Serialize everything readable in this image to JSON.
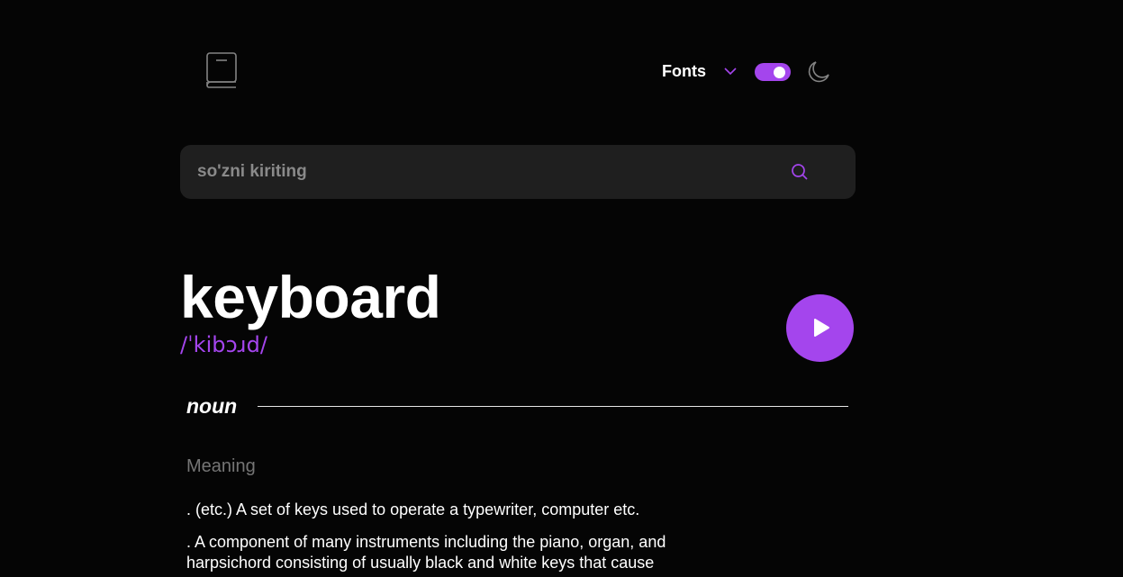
{
  "header": {
    "logo_icon": "book-icon",
    "font_selector": {
      "label": "Fonts",
      "icon": "chevron-down-icon"
    },
    "theme_toggle": {
      "state": "on",
      "accent": "#a445ed"
    },
    "theme_icon": "moon-icon"
  },
  "search": {
    "placeholder": "so'zni kiriting",
    "value": "",
    "icon": "search-icon"
  },
  "entry": {
    "word": "keyboard",
    "phonetic": "/ˈkibɔɹd/",
    "play_icon": "play-icon",
    "part_of_speech": "noun",
    "meaning_heading": "Meaning",
    "definitions": [
      ". (etc.) A set of keys used to operate a typewriter, computer etc.",
      ". A component of many instruments including the piano, organ, and harpsichord consisting of usually black and white keys that cause"
    ]
  },
  "colors": {
    "background": "#050505",
    "accent": "#a445ed",
    "search_bg": "#1f1f1f",
    "muted_text": "#757575"
  }
}
